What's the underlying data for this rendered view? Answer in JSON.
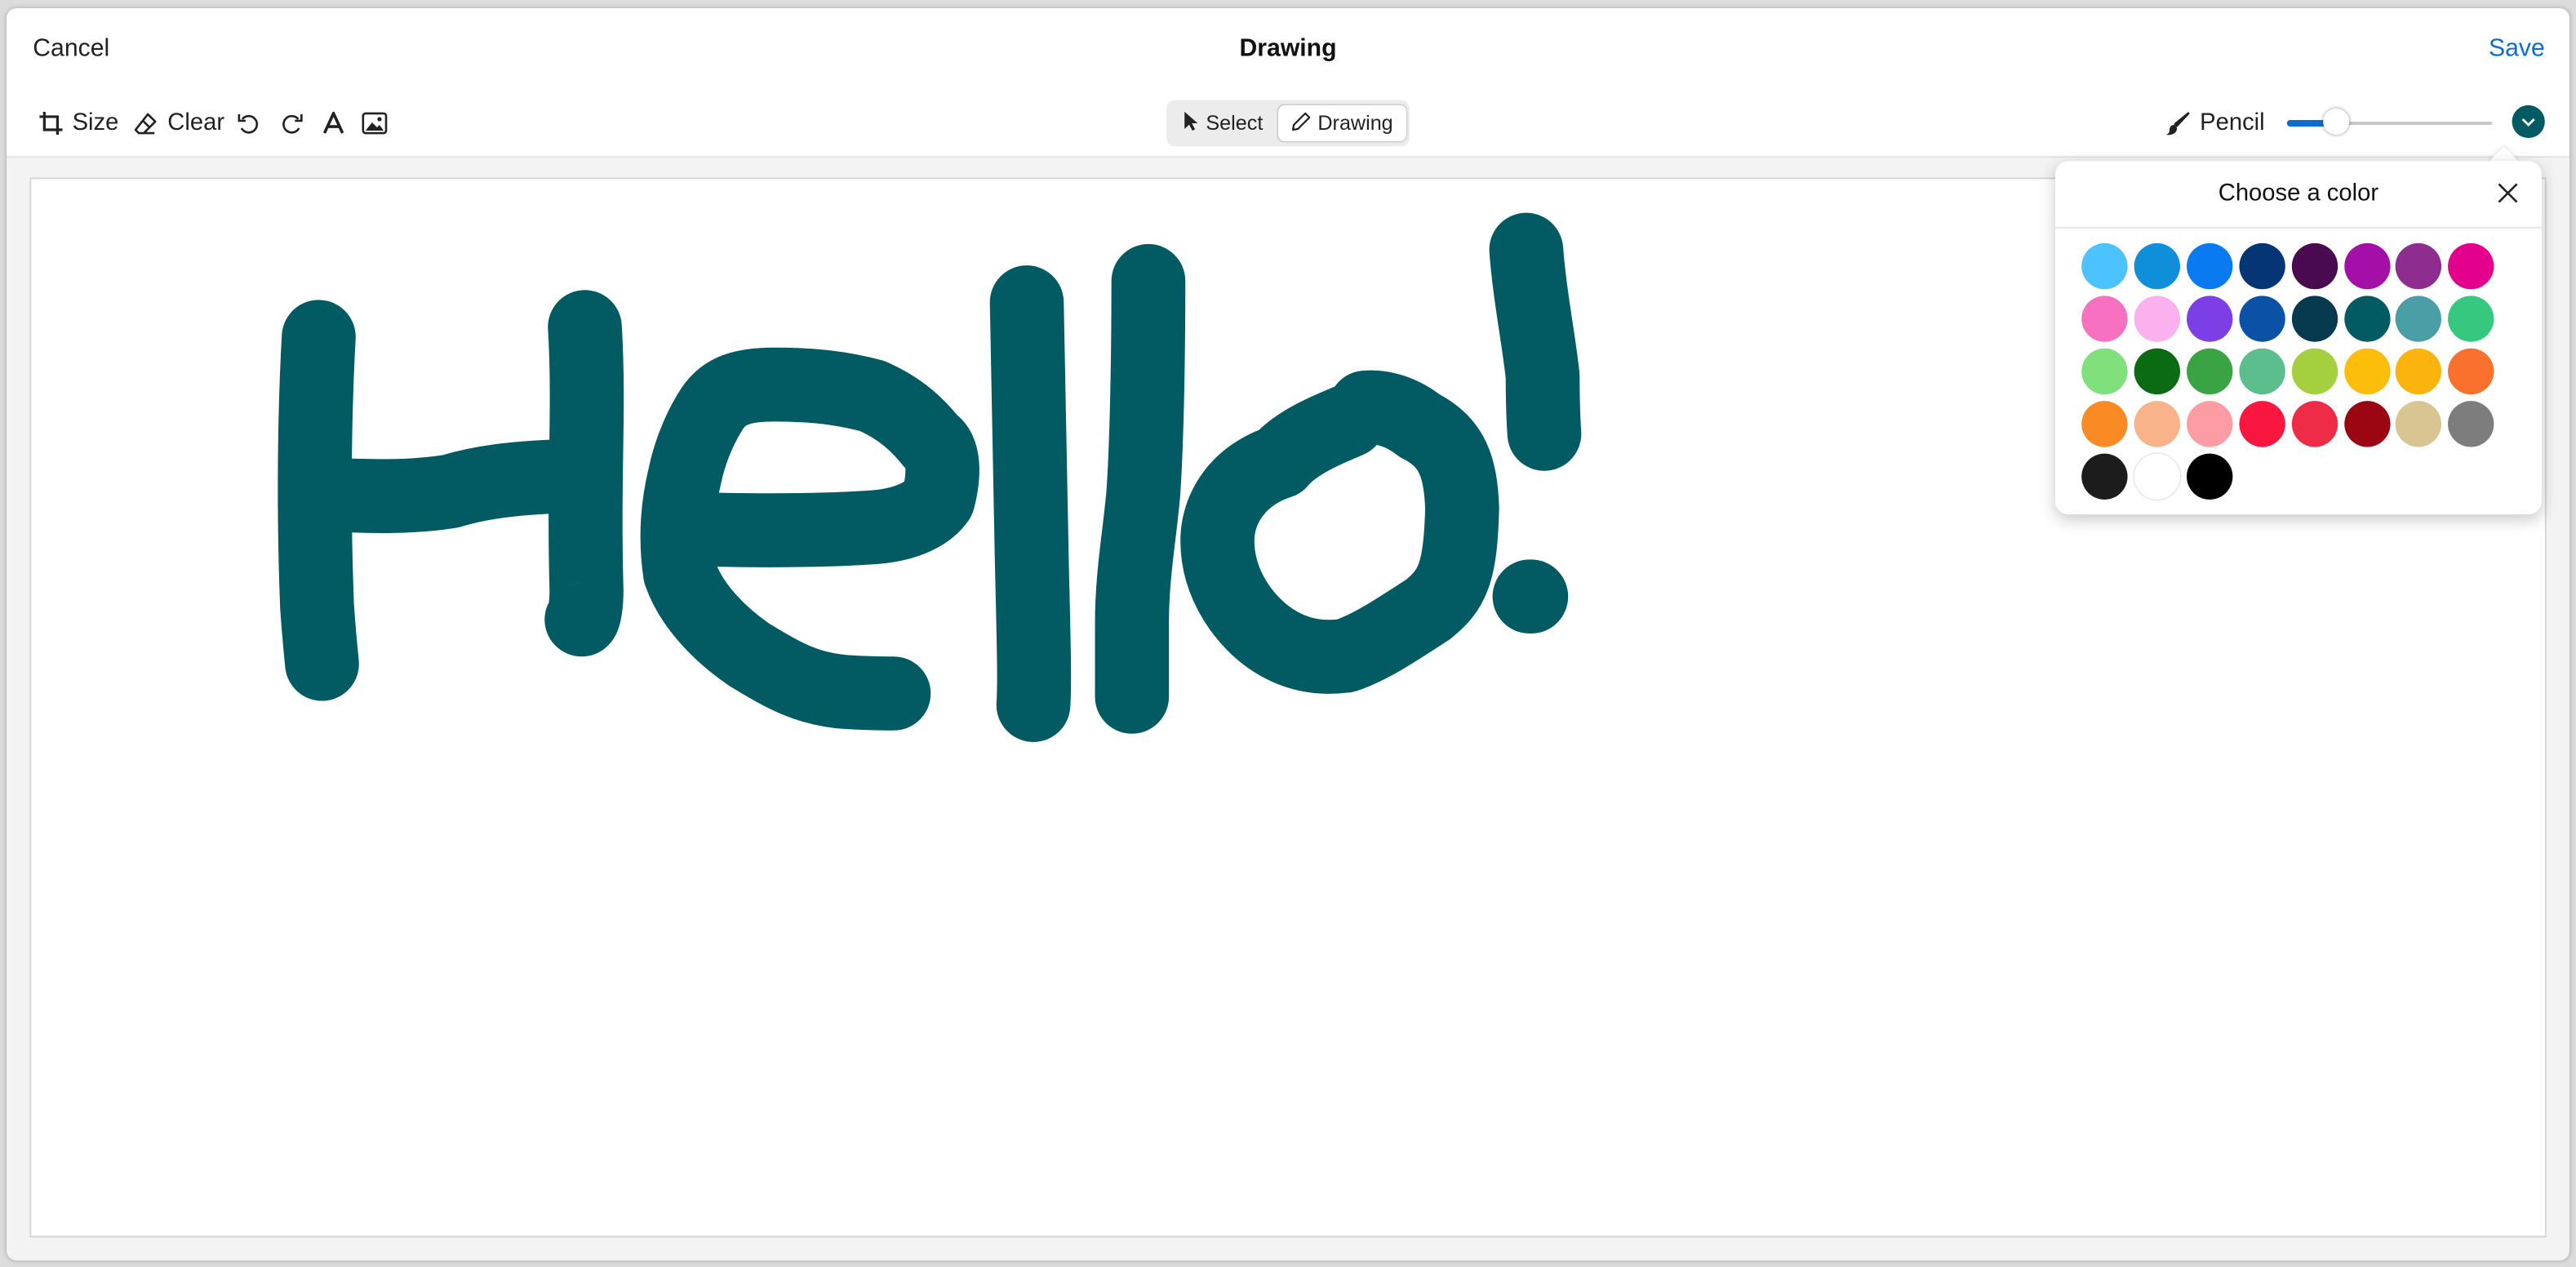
{
  "header": {
    "cancel_label": "Cancel",
    "title": "Drawing",
    "save_label": "Save"
  },
  "toolbar": {
    "size_label": "Size",
    "clear_label": "Clear",
    "undo_icon": "undo-icon",
    "redo_icon": "redo-icon",
    "text_icon": "text-icon",
    "image_icon": "image-icon",
    "modes": {
      "select_label": "Select",
      "drawing_label": "Drawing",
      "active": "Drawing"
    },
    "brush_label": "Pencil",
    "brush_size": 0.24,
    "current_color": "#025b62"
  },
  "color_picker": {
    "title": "Choose a color",
    "colors": [
      "#4cc2ff",
      "#0f8fd9",
      "#0a7af0",
      "#063575",
      "#4a0a4f",
      "#a40fa8",
      "#8e2c8f",
      "#e3008c",
      "#f870c0",
      "#fbb1ee",
      "#7c3fe6",
      "#0b51a6",
      "#063a4f",
      "#025b62",
      "#4a9ea6",
      "#37c880",
      "#7fe07c",
      "#0a6b13",
      "#3aa343",
      "#5cbd8d",
      "#a4cf3e",
      "#fcbe0a",
      "#fbb40e",
      "#f9712d",
      "#f98a24",
      "#f9b388",
      "#fe9ca3",
      "#f9173f",
      "#ee2c48",
      "#9a0713",
      "#d8c591",
      "#7d7d7d",
      "#1c1c1c",
      "#ffffff",
      "#000000"
    ]
  },
  "canvas": {
    "stroke_color": "#025b62"
  }
}
